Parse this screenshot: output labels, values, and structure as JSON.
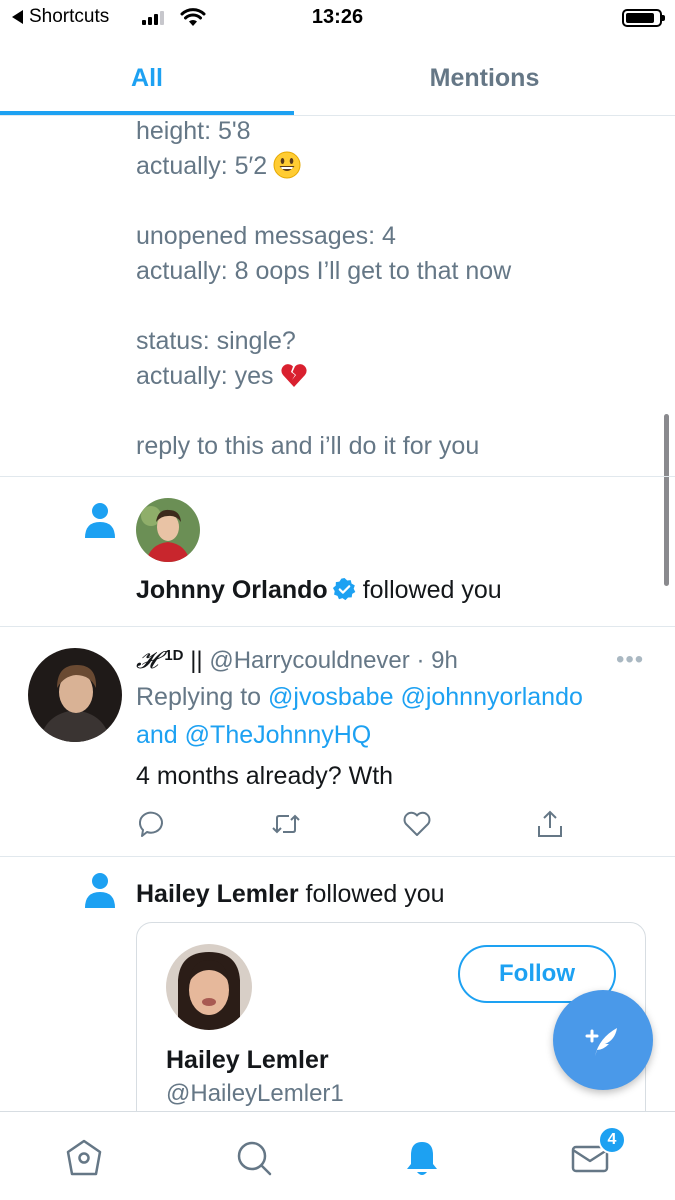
{
  "status_bar": {
    "back_label": "Shortcuts",
    "time": "13:26"
  },
  "tabs": [
    {
      "label": "All",
      "active": true
    },
    {
      "label": "Mentions",
      "active": false
    }
  ],
  "tweet_text": {
    "lines": [
      "height: 5'8",
      "actually: 5′2",
      "unopened messages: 4",
      "actually: 8 oops I’ll get to that now",
      "status: single?",
      "actually: yes",
      "reply to this and i’ll do it for you"
    ]
  },
  "notifications": [
    {
      "type": "follow",
      "name": "Johnny Orlando",
      "verified": true,
      "action": "followed you"
    },
    {
      "type": "reply",
      "display_name_prefix": "𝓗",
      "display_name_sup": "1D",
      "display_name_bar": "||",
      "handle": "@Harrycouldnever",
      "time": "· 9h",
      "replying_to_label": "Replying to",
      "mentions": [
        "@jvosbabe",
        "@johnnyorlando"
      ],
      "and_label": "and",
      "last_mention": "@TheJohnnyHQ",
      "body": "4 months already? Wth"
    },
    {
      "type": "follow",
      "name": "Hailey Lemler",
      "action": "followed you",
      "card": {
        "follow_label": "Follow",
        "name": "Hailey Lemler",
        "handle": "@HaileyLemler1"
      }
    }
  ],
  "bottom_nav": {
    "items": [
      "home-icon",
      "search-icon",
      "notifications-icon",
      "messages-icon"
    ],
    "messages_badge": "4"
  },
  "colors": {
    "accent": "#1da1f2",
    "secondary_text": "#657786",
    "primary_text": "#14171a"
  }
}
